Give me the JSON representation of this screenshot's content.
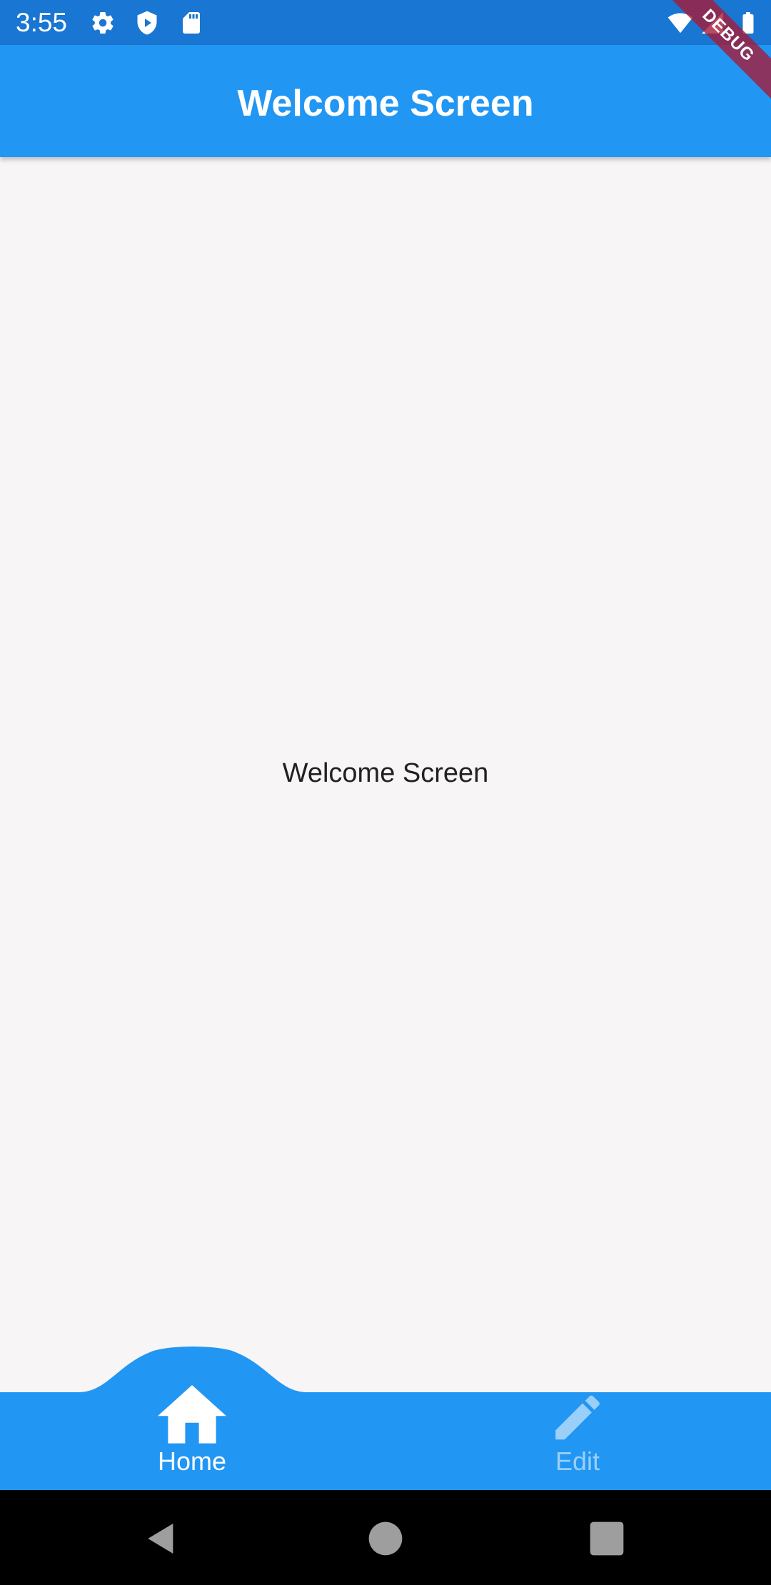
{
  "status_bar": {
    "time": "3:55",
    "left_icons": [
      "gear-icon",
      "shield-icon",
      "sd-card-icon"
    ],
    "right_icons": [
      "wifi-icon",
      "signal-icon",
      "battery-icon"
    ],
    "color": "#1976d2"
  },
  "debug_banner": {
    "label": "DEBUG"
  },
  "app_bar": {
    "title": "Welcome Screen",
    "color": "#2196f3"
  },
  "body": {
    "text": "Welcome Screen"
  },
  "bottom_nav": {
    "color": "#2196f3",
    "items": [
      {
        "label": "Home",
        "icon": "home-icon",
        "selected": true
      },
      {
        "label": "Edit",
        "icon": "edit-icon",
        "selected": false
      }
    ]
  },
  "system_nav": {
    "buttons": [
      "back-icon",
      "home-circle-icon",
      "recents-icon"
    ]
  }
}
